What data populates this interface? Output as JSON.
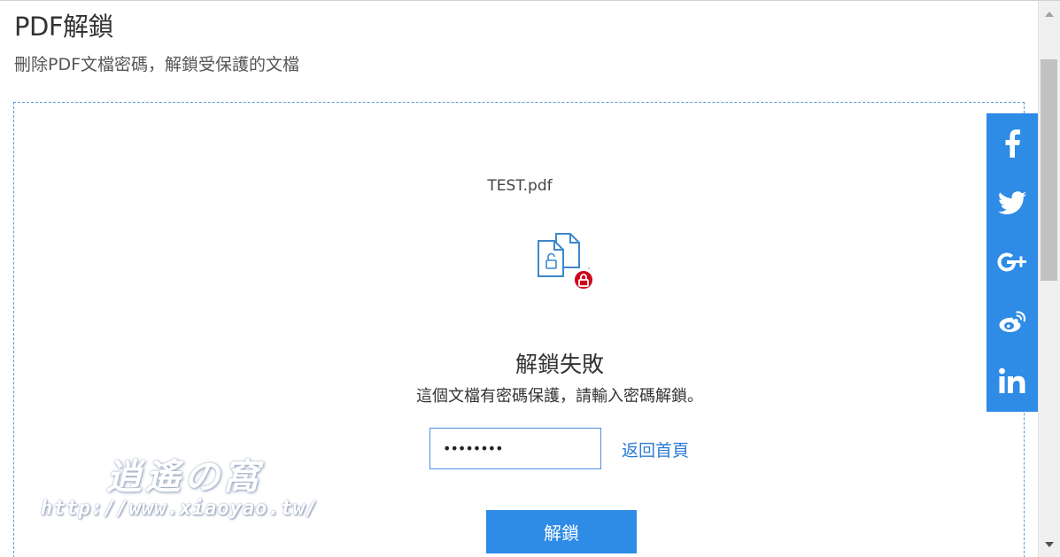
{
  "header": {
    "title": "PDF解鎖",
    "subtitle": "刪除PDF文檔密碼，解鎖受保護的文檔"
  },
  "file": {
    "name": "TEST.pdf"
  },
  "result": {
    "title": "解鎖失敗",
    "message": "這個文檔有密碼保護，請輸入密碼解鎖。"
  },
  "password_field": {
    "value": "••••••••",
    "placeholder": ""
  },
  "links": {
    "back_home": "返回首頁"
  },
  "buttons": {
    "unlock": "解鎖"
  },
  "share_bar": {
    "items": [
      {
        "name": "facebook",
        "icon": "facebook-icon"
      },
      {
        "name": "twitter",
        "icon": "twitter-icon"
      },
      {
        "name": "google-plus",
        "icon": "google-plus-icon"
      },
      {
        "name": "weibo",
        "icon": "weibo-icon"
      },
      {
        "name": "linkedin",
        "icon": "linkedin-icon"
      }
    ]
  },
  "watermark": {
    "logo_text": "逍遙の窩",
    "url": "http://www.xiaoyao.tw/"
  },
  "colors": {
    "accent": "#2e8be6",
    "link": "#2b7cd3",
    "lock_badge": "#d0021b",
    "dashed_border": "#5a9bd8"
  }
}
